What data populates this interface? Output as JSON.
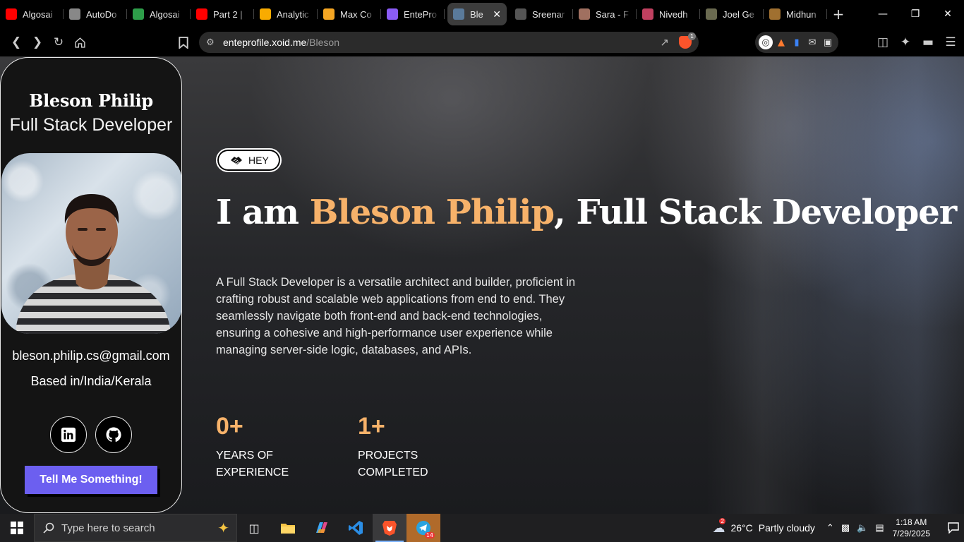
{
  "browser": {
    "tabs": [
      {
        "title": "Algosai",
        "favicon": "youtube-icon",
        "color": "#ff0000"
      },
      {
        "title": "AutoDo",
        "favicon": "globe-icon",
        "color": "#888888"
      },
      {
        "title": "Algosai",
        "favicon": "green-logo-icon",
        "color": "#2e9e4a"
      },
      {
        "title": "Part 2 |",
        "favicon": "youtube-icon",
        "color": "#ff0000"
      },
      {
        "title": "Analytic",
        "favicon": "analytics-icon",
        "color": "#f9ab00"
      },
      {
        "title": "Max Co",
        "favicon": "stripe-icon",
        "color": "#f5a623"
      },
      {
        "title": "EntePro",
        "favicon": "entepro-icon",
        "color": "#8b5cf6"
      },
      {
        "title": "Ble",
        "favicon": "profile-photo-icon",
        "color": "#5a7a9a",
        "active": true
      },
      {
        "title": "Sreenar",
        "favicon": "profile-photo-icon",
        "color": "#555555"
      },
      {
        "title": "Sara - F",
        "favicon": "profile-photo-icon",
        "color": "#a07060"
      },
      {
        "title": "Nivedh",
        "favicon": "profile-photo-icon",
        "color": "#c04060"
      },
      {
        "title": "Joel Ge",
        "favicon": "profile-photo-icon",
        "color": "#6a6a50"
      },
      {
        "title": "Midhun",
        "favicon": "profile-photo-icon",
        "color": "#a07030"
      }
    ],
    "url_host": "enteprofile.xoid.me",
    "url_path": "/Bleson",
    "shields_count": "1"
  },
  "profile": {
    "name": "Bleson Philip",
    "role": "Full Stack Developer",
    "email": "bleson.philip.cs@gmail.com",
    "location": "Based in/India/Kerala",
    "cta": "Tell Me Something!"
  },
  "hero": {
    "badge": "HEY",
    "headline_prefix": "I am ",
    "headline_name": "Bleson Philip",
    "headline_suffix": ", Full Stack Developer",
    "description": "A Full Stack Developer is a versatile architect and builder, proficient in crafting robust and scalable web applications from end to end. They seamlessly navigate both front-end and back-end technologies, ensuring a cohesive and high-performance user experience while managing server-side logic, databases, and APIs.",
    "stats": [
      {
        "value": "0+",
        "label_line1": "YEARS OF",
        "label_line2": "EXPERIENCE"
      },
      {
        "value": "1+",
        "label_line1": "PROJECTS",
        "label_line2": "COMPLETED"
      }
    ],
    "accent_color": "#f7b26a",
    "cta_color": "#6c5ff0"
  },
  "taskbar": {
    "search_placeholder": "Type here to search",
    "weather_temp": "26°C",
    "weather_text": "Partly cloudy",
    "weather_badge": "2",
    "time": "1:18 AM",
    "date": "7/29/2025",
    "telegram_badge": "14"
  }
}
